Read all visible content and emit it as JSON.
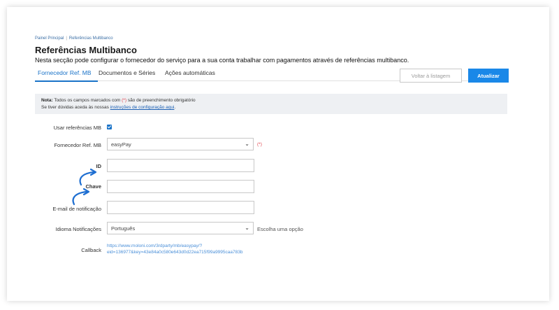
{
  "breadcrumb": {
    "item1": "Painel Principal",
    "separator": "|",
    "item2": "Referências Multibanco"
  },
  "page": {
    "title": "Referências Multibanco",
    "description": "Nesta secção pode configurar o fornecedor do serviço para a sua conta trabalhar com pagamentos através de referências multibanco."
  },
  "tabs": {
    "tab1": "Fornecedor Ref. MB",
    "tab2": "Documentos e Séries",
    "tab3": "Ações automáticas"
  },
  "buttons": {
    "back": "Voltar à listagem",
    "update": "Atualizar"
  },
  "note": {
    "prefix": "Nota:",
    "line1_a": "Todos os campos marcados com",
    "req_mark": "(*)",
    "line1_b": "são de preenchimento obrigatório",
    "line2_a": "Se tiver dúvidas aceda às nossas",
    "link": "instruções de configuração aqui",
    "line2_end": "."
  },
  "form": {
    "usar_label": "Usar referências MB",
    "usar_checked": true,
    "fornecedor_label": "Fornecedor Ref. MB",
    "fornecedor_value": "easyPay",
    "fornecedor_req": "(*)",
    "id_label": "ID",
    "chave_label": "Chave",
    "email_label": "E-mail de notificação",
    "idioma_label": "Idioma Notificações",
    "idioma_value": "Português",
    "idioma_hint": "Escolha uma opção",
    "callback_label": "Callback",
    "callback_line1": "https://www.moloni.com/3rdparty/mb/easypay/?",
    "callback_line2": "eid=136977&key=43e84a0c580e643d0d22ea715f99a9995caa783b"
  },
  "icons": {
    "chevron": "chevron-down-icon",
    "arrow": "curved-arrow-icon",
    "check": "check-icon"
  },
  "colors": {
    "accent": "#1a88e8",
    "tab_active": "#1a73c8",
    "required": "#e0404a",
    "link": "#4a8fd8",
    "note_bg": "#eef0f3",
    "arrow": "#1f6fd1"
  }
}
